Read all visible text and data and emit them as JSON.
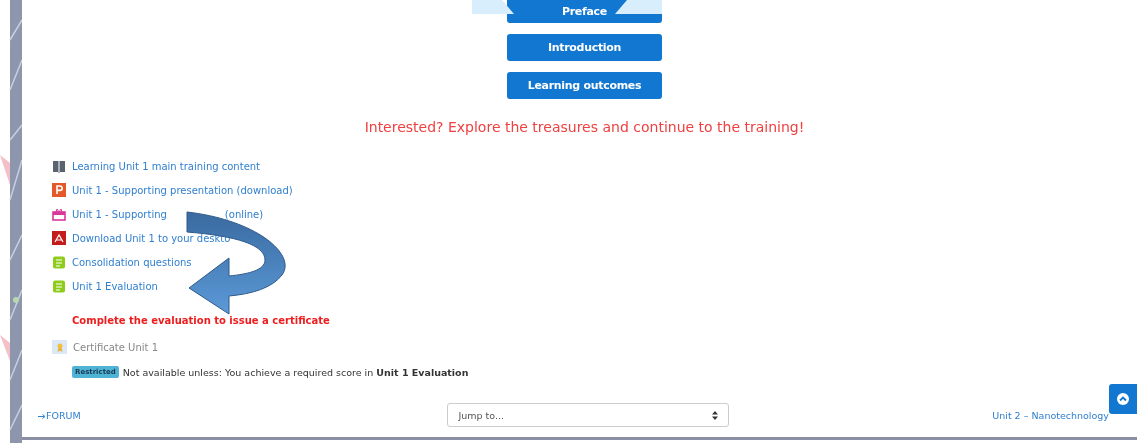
{
  "nav_buttons": [
    {
      "label": "Preface"
    },
    {
      "label": "Introduction"
    },
    {
      "label": "Learning outcomes"
    }
  ],
  "banner": "Interested? Explore the treasures and continue to the training!",
  "activities": [
    {
      "kind": "book",
      "label": "Learning Unit 1 main training content",
      "disabled": false
    },
    {
      "kind": "presentation",
      "label": "Unit 1 - Supporting presentation (download)",
      "disabled": false
    },
    {
      "kind": "interactive",
      "label": "Unit 1 - Supporting",
      "label_tail": "(online)",
      "disabled": false
    },
    {
      "kind": "pdf",
      "label": "Download Unit 1 to your deskto",
      "disabled": false
    },
    {
      "kind": "quiz",
      "label": "Consolidation questions",
      "disabled": false
    },
    {
      "kind": "quiz",
      "label": "Unit 1 Evaluation",
      "disabled": false
    },
    {
      "kind": "note",
      "label": "Complete the evaluation to issue a certificate"
    },
    {
      "kind": "certificate",
      "label": "Certificate Unit 1",
      "disabled": true
    },
    {
      "kind": "restriction",
      "badge": "Restricted",
      "label": "Not available unless: You achieve a required score in **Unit 1 Evaluation**"
    }
  ],
  "footer": {
    "previous": "FORUM",
    "jump": {
      "placeholder": "Jump to..."
    },
    "next": "Unit 2 – Nanotechnology"
  }
}
